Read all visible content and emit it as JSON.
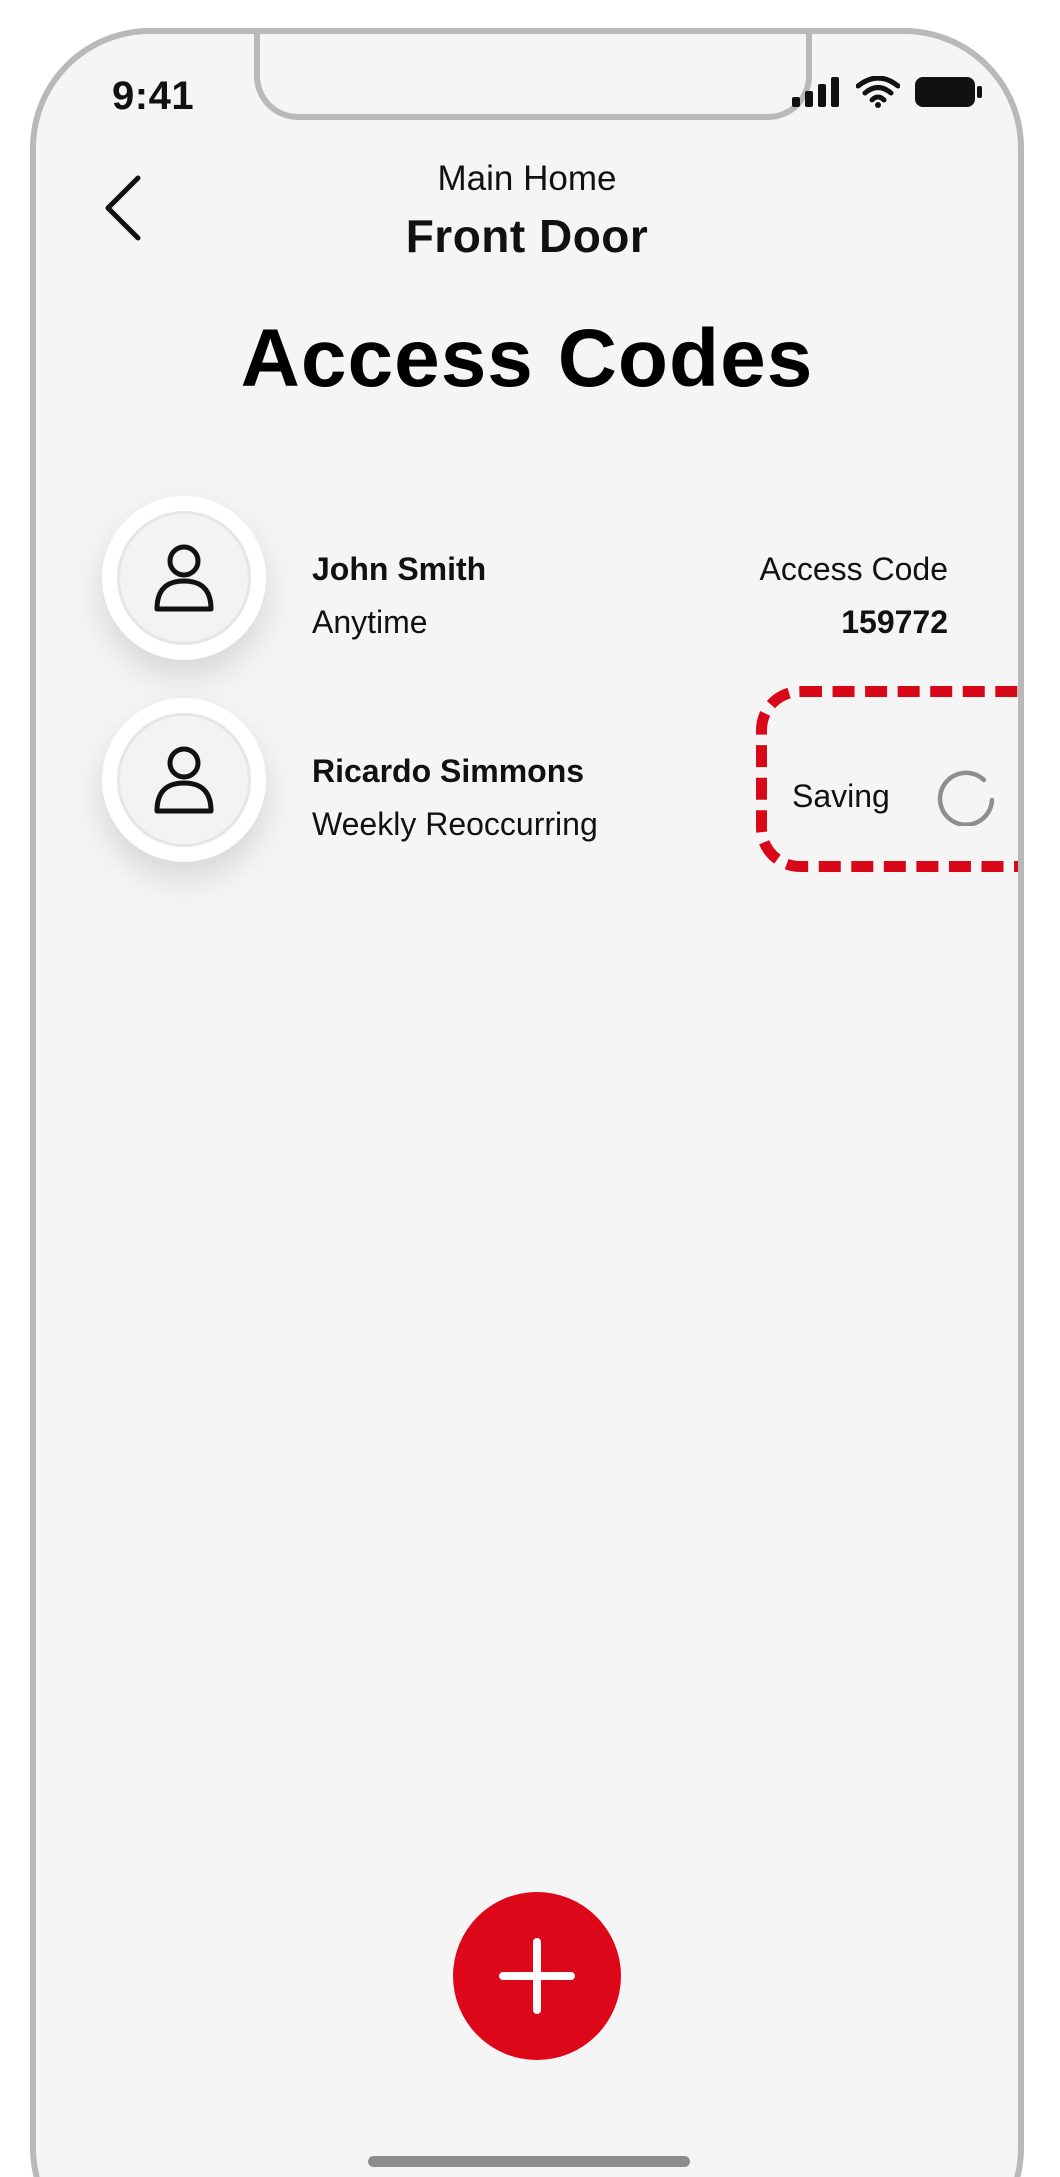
{
  "status_bar": {
    "time": "9:41",
    "icons": [
      "cellular-signal-icon",
      "wifi-icon",
      "battery-icon"
    ]
  },
  "header": {
    "back_icon": "chevron-left-icon",
    "location": "Main Home",
    "device": "Front Door"
  },
  "page_title": "Access Codes",
  "users": [
    {
      "name": "John Smith",
      "schedule": "Anytime",
      "code_label": "Access Code",
      "code_value": "159772"
    },
    {
      "name": "Ricardo Simmons",
      "schedule": "Weekly Reoccurring",
      "status": "Saving"
    }
  ],
  "fab": {
    "icon": "plus-icon"
  },
  "colors": {
    "accent": "#dc0718",
    "highlight": "#d90818",
    "background": "#f5f5f5",
    "frame": "#b9b9b9"
  }
}
